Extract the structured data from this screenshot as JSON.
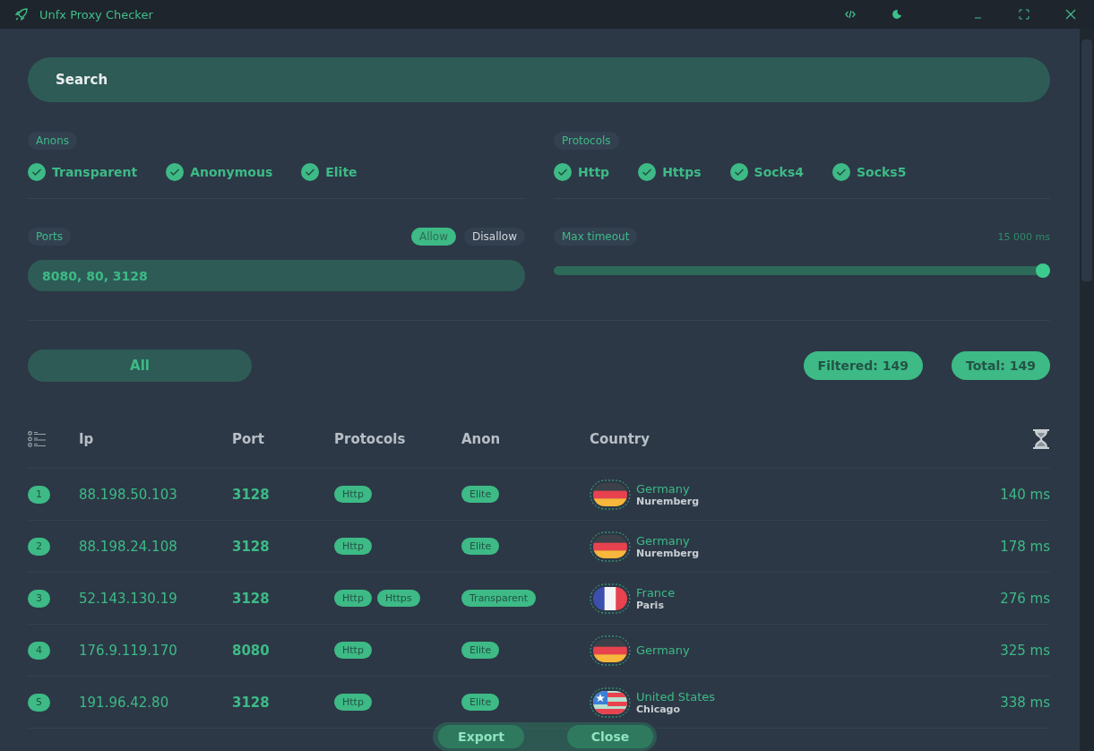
{
  "window": {
    "title": "Unfx Proxy Checker"
  },
  "search": {
    "placeholder": "Search"
  },
  "anons": {
    "label": "Anons",
    "options": [
      {
        "label": "Transparent",
        "checked": true
      },
      {
        "label": "Anonymous",
        "checked": true
      },
      {
        "label": "Elite",
        "checked": true
      }
    ]
  },
  "protocols": {
    "label": "Protocols",
    "options": [
      {
        "label": "Http",
        "checked": true
      },
      {
        "label": "Https",
        "checked": true
      },
      {
        "label": "Socks4",
        "checked": true
      },
      {
        "label": "Socks5",
        "checked": true
      }
    ]
  },
  "ports": {
    "label": "Ports",
    "modes": [
      {
        "label": "Allow",
        "selected": true
      },
      {
        "label": "Disallow",
        "selected": false
      }
    ],
    "value": "8080, 80, 3128"
  },
  "timeout": {
    "label": "Max timeout",
    "reading": "15 000 ms",
    "level": 1
  },
  "filter_button": "All",
  "counters": [
    "Filtered: 149",
    "Total: 149"
  ],
  "table": {
    "columns": [
      "Ip",
      "Port",
      "Protocols",
      "Anon",
      "Country"
    ],
    "rows": [
      {
        "index": "1",
        "ip": "88.198.50.103",
        "port": "3128",
        "protocols": [
          "Http"
        ],
        "anon": "Elite",
        "country": {
          "kind": "de",
          "name": "Germany",
          "city": "Nuremberg"
        },
        "time": "140 ms"
      },
      {
        "index": "2",
        "ip": "88.198.24.108",
        "port": "3128",
        "protocols": [
          "Http"
        ],
        "anon": "Elite",
        "country": {
          "kind": "de",
          "name": "Germany",
          "city": "Nuremberg"
        },
        "time": "178 ms"
      },
      {
        "index": "3",
        "ip": "52.143.130.19",
        "port": "3128",
        "protocols": [
          "Http",
          "Https"
        ],
        "anon": "Transparent",
        "country": {
          "kind": "fr",
          "name": "France",
          "city": "Paris"
        },
        "time": "276 ms"
      },
      {
        "index": "4",
        "ip": "176.9.119.170",
        "port": "8080",
        "protocols": [
          "Http"
        ],
        "anon": "Elite",
        "country": {
          "kind": "de",
          "name": "Germany"
        },
        "time": "325 ms"
      },
      {
        "index": "5",
        "ip": "191.96.42.80",
        "port": "3128",
        "protocols": [
          "Http"
        ],
        "anon": "Elite",
        "country": {
          "kind": "us",
          "name": "United States",
          "city": "Chicago"
        },
        "time": "338 ms"
      }
    ]
  },
  "floating_actions": [
    "Export",
    "Close"
  ]
}
